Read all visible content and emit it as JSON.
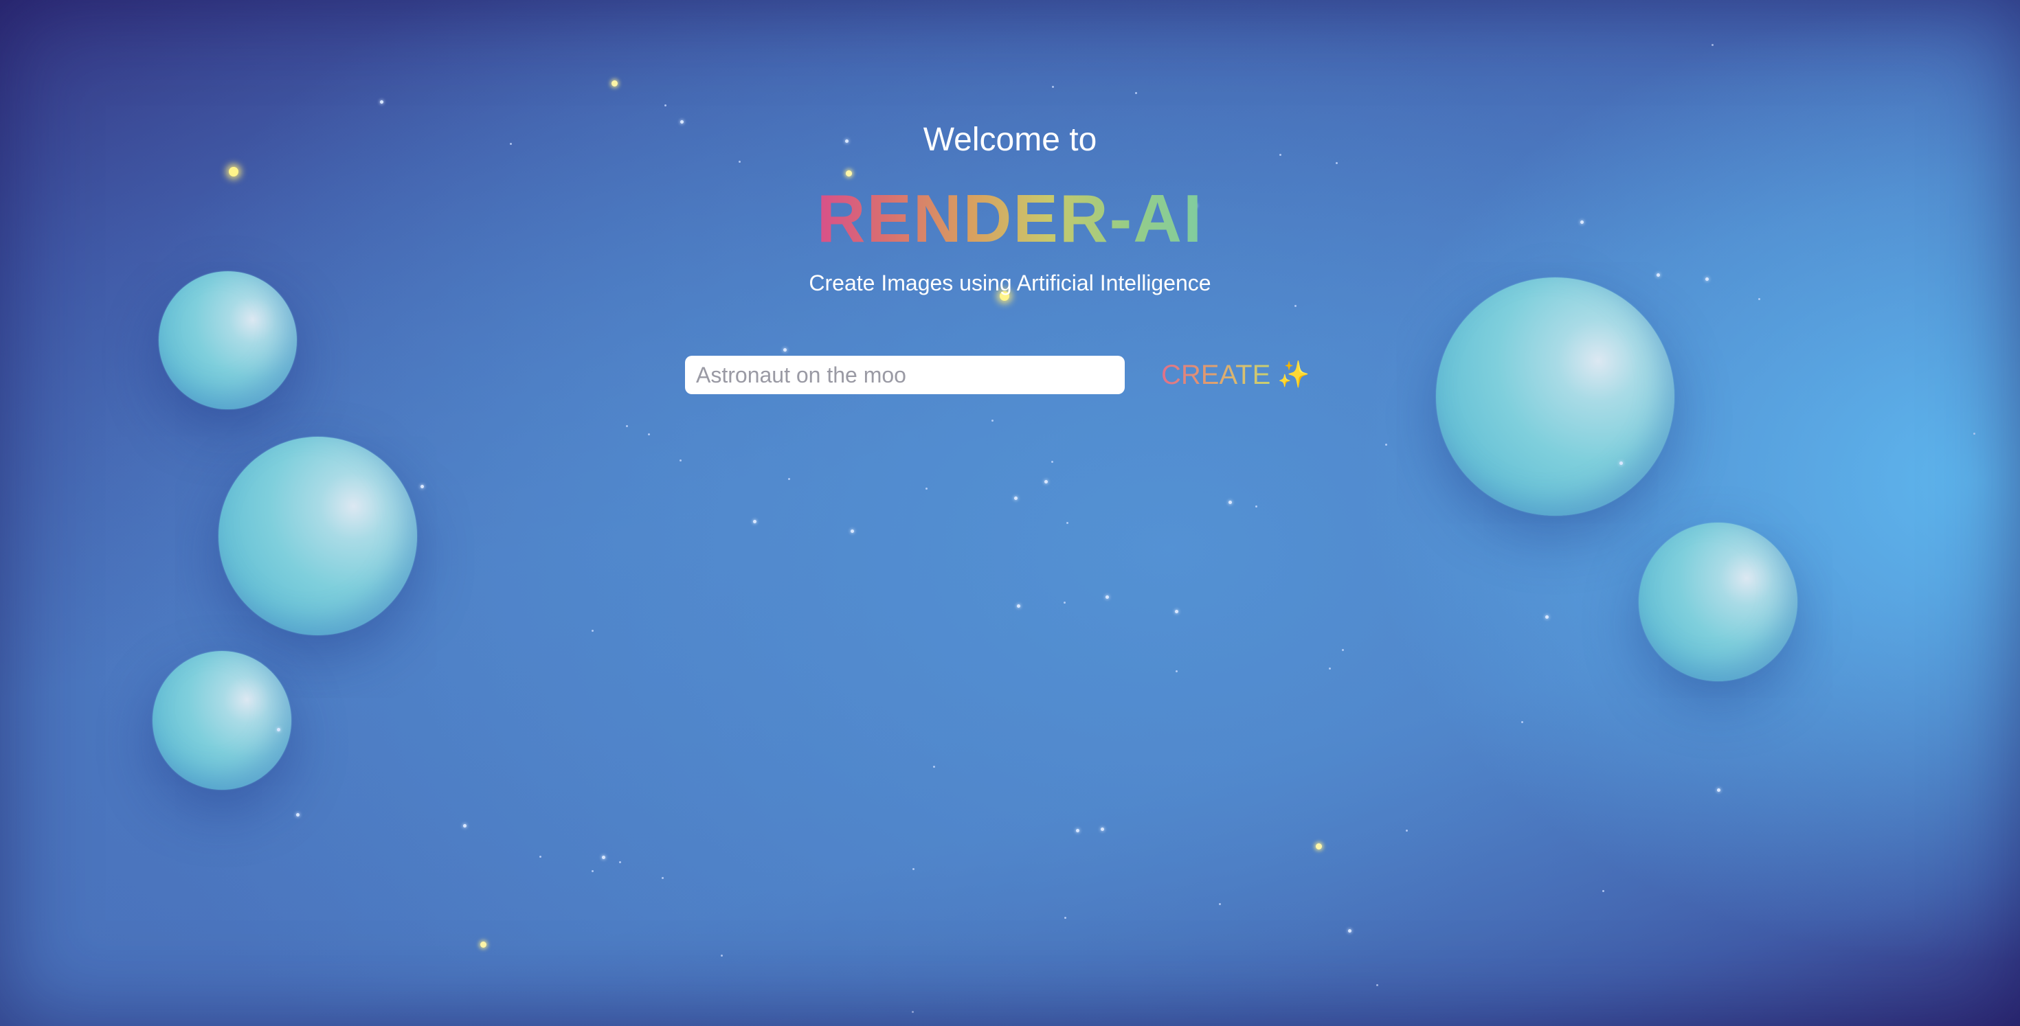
{
  "hero": {
    "welcome": "Welcome to",
    "brand": "RENDER-AI",
    "tagline": "Create Images using Artificial Intelligence"
  },
  "prompt": {
    "value": "",
    "placeholder": "Astronaut on the moo"
  },
  "create_button": {
    "label": "CREATE",
    "icon": "✨"
  },
  "colors": {
    "background_top": "#33337f",
    "background_mid": "#4a74bd",
    "accent_light": "#5fb9f0",
    "bubble": "#7fcfdc",
    "brand_gradient_start": "#d8508a",
    "brand_gradient_end": "#80cca0",
    "star": "#fff48a"
  }
}
